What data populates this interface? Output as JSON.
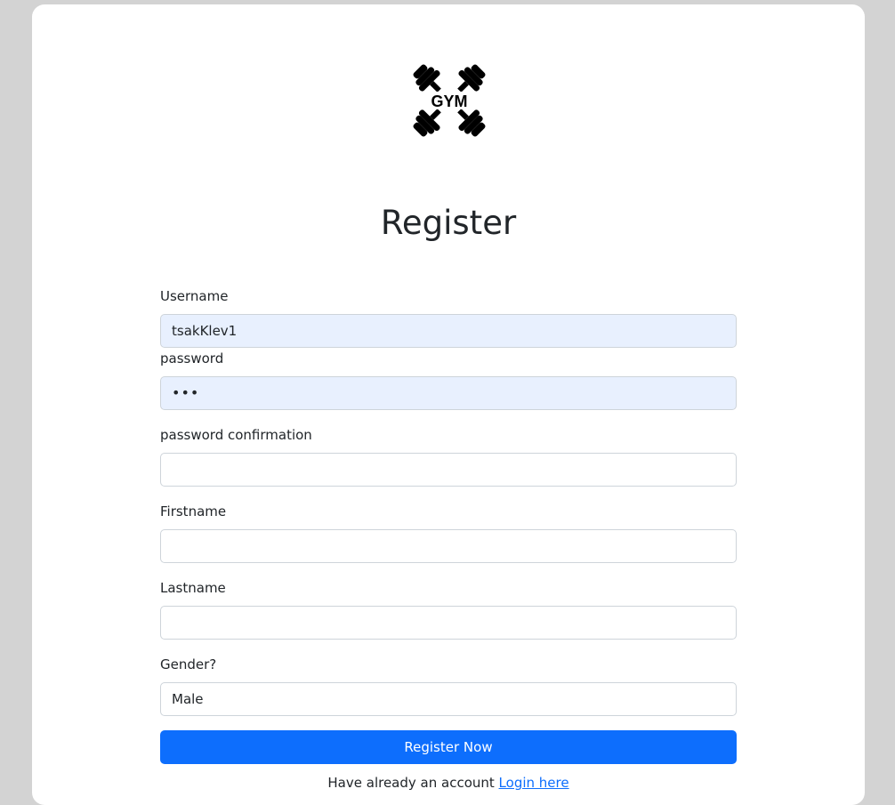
{
  "page": {
    "title": "Register",
    "logo_text": "GYM"
  },
  "form": {
    "username": {
      "label": "Username",
      "value": "tsakKlev1"
    },
    "password": {
      "label": "password",
      "value": "•••"
    },
    "password_confirmation": {
      "label": "password confirmation",
      "value": ""
    },
    "firstname": {
      "label": "Firstname",
      "value": ""
    },
    "lastname": {
      "label": "Lastname",
      "value": ""
    },
    "gender": {
      "label": "Gender?",
      "value": "Male",
      "options": [
        "Male"
      ]
    },
    "submit_label": "Register Now"
  },
  "footer": {
    "prompt": "Have already an account",
    "login_link": "Login here"
  },
  "colors": {
    "page_background": "#d3d3d3",
    "card_background": "#ffffff",
    "primary": "#0d6efd",
    "autofill": "#e8f0fe"
  }
}
